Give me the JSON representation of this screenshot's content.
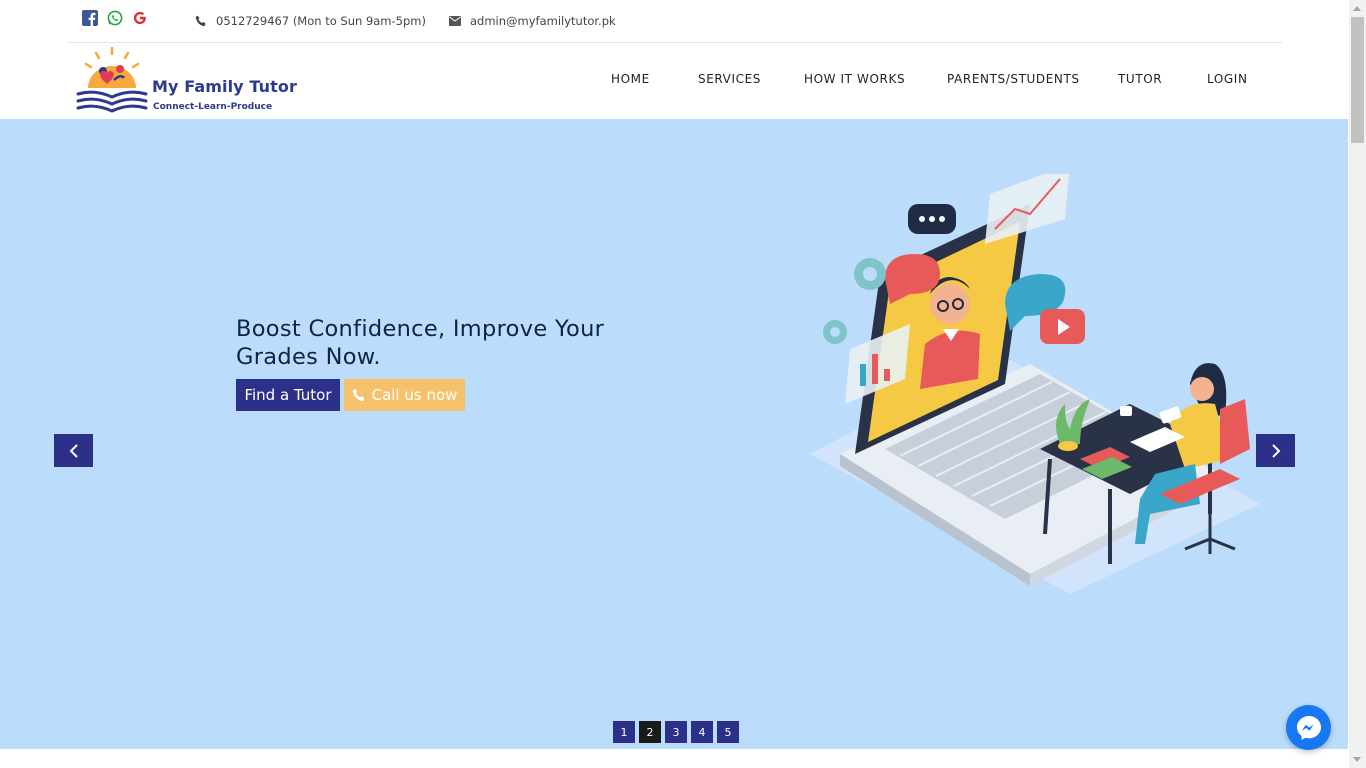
{
  "topbar": {
    "social": [
      {
        "icon": "facebook-icon",
        "color": "#3b5998"
      },
      {
        "icon": "whatsapp-icon",
        "color": "#25a244"
      },
      {
        "icon": "google-icon",
        "color": "#db3236"
      }
    ],
    "phone": "0512729467 (Mon to Sun 9am-5pm)",
    "email": "admin@myfamilytutor.pk"
  },
  "logo": {
    "name": "My Family Tutor",
    "tagline": "Connect-Learn-Produce"
  },
  "nav": {
    "items": [
      "HOME",
      "SERVICES",
      "HOW IT WORKS",
      "PARENTS/STUDENTS",
      "TUTOR",
      "LOGIN"
    ]
  },
  "hero": {
    "headline": "Boost Confidence, Improve Your Grades Now.",
    "find_tutor": "Find a Tutor",
    "call_us": "Call us now",
    "pager": [
      "1",
      "2",
      "3",
      "4",
      "5"
    ],
    "active_slide": "2",
    "bg_color": "#bbdcfb",
    "accent_color": "#2d3089",
    "cta_color": "#f5c16a"
  }
}
